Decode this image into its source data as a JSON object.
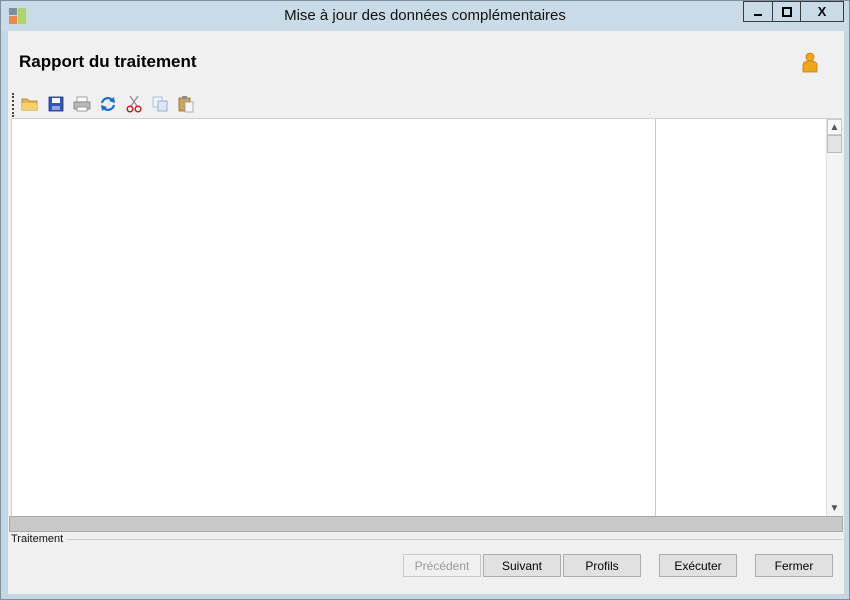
{
  "window": {
    "title": "Mise à jour des données complémentaires",
    "controls": {
      "minimize": "—",
      "maximize": "□",
      "close": "X"
    }
  },
  "header": {
    "title": "Rapport du traitement",
    "user_icon": "person-icon"
  },
  "toolbar": {
    "items": [
      {
        "name": "open-icon",
        "interactable": true
      },
      {
        "name": "save-icon",
        "interactable": true
      },
      {
        "name": "print-icon",
        "interactable": true
      },
      {
        "name": "refresh-icon",
        "interactable": true
      },
      {
        "name": "cut-icon",
        "interactable": true
      },
      {
        "name": "copy-icon",
        "interactable": true
      },
      {
        "name": "paste-icon",
        "interactable": true
      }
    ]
  },
  "report": {
    "content": ""
  },
  "group": {
    "label": "Traitement"
  },
  "buttons": {
    "previous": "Précédent",
    "next": "Suivant",
    "profiles": "Profils",
    "execute": "Exécuter",
    "close": "Fermer"
  },
  "colors": {
    "titlebar": "#c9dbe6",
    "client": "#f0f0f0",
    "progress": "#c8c8c8"
  }
}
